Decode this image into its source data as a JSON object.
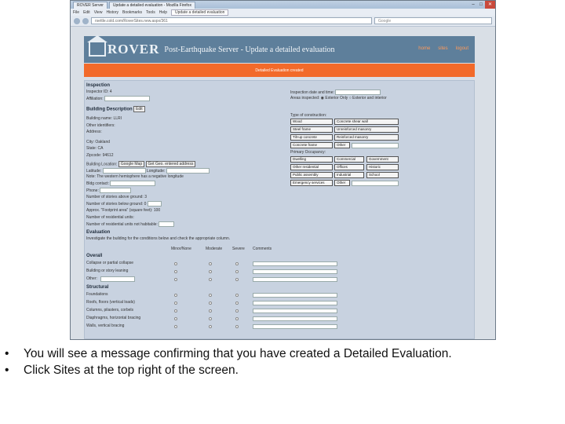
{
  "browser": {
    "tabs": [
      "ROVER Server",
      "Update a detailed evaluation - Mozilla Firefox"
    ],
    "menu": [
      "File",
      "Edit",
      "View",
      "History",
      "Bookmarks",
      "Tools",
      "Help"
    ],
    "active_tab": "Update a detailed evaluation",
    "url": "rsettle.cold.com/RoverSites.new.aspx/361",
    "search_placeholder": "Google"
  },
  "header": {
    "logo_text": "ROVER",
    "title": "Post-Earthquake Server - Update a detailed evaluation",
    "nav": [
      "home",
      "sites",
      "logout"
    ]
  },
  "flash_message": "Detailed Evaluation created",
  "inspection": {
    "heading": "Inspection",
    "inspector_id": "Inspector ID: 4",
    "affiliation_label": "Affiliation:",
    "date_label": "Inspection date and time:",
    "areas_label": "Areas inspected:",
    "areas_options": [
      "Exterior Only",
      "Exterior and interior"
    ]
  },
  "building": {
    "heading": "Building Description",
    "edit_label": "Edit",
    "lines": [
      "Building name: LLRI",
      "Other identifiers:",
      "Address:",
      "",
      "City: Oakland",
      "State: CA",
      "Zipcode: 94612"
    ],
    "latlong_label": "Building Location:",
    "google_map_btn": "Google Map",
    "geocode_btn": "Get Geo. entered address",
    "latitude_label": "Latitude:",
    "longitude_label": "Longitude:",
    "note": "Note: The western hemisphere has a negative longitude",
    "more_lines": [
      "Bldg contact:",
      "Phone:",
      "Number of stories above ground: 3",
      "Number of stories below ground: 0",
      "Approx. \"Footprint area\" (square feet): 100",
      "Number of residential units:",
      "Number of residential units not habitable:"
    ]
  },
  "construction": {
    "type_label": "Type of construction:",
    "types": [
      "Wood",
      "Concrete shear wall",
      "Steel frame",
      "Unreinforced masonry",
      "Tilt-up concrete",
      "Reinforced masonry",
      "Concrete frame",
      "Other"
    ],
    "occupancy_label": "Primary Occupancy:",
    "occupancies": [
      "Dwelling",
      "Commercial",
      "Government",
      "Other residential",
      "Offices",
      "Historic",
      "Public assembly",
      "Industrial",
      "School",
      "Emergency services",
      "Other"
    ]
  },
  "evaluation": {
    "heading": "Evaluation",
    "intro": "Investigate the building for the conditions below and check the appropriate column.",
    "columns": [
      "Minor/None",
      "Moderate",
      "Severe",
      "Comments"
    ],
    "groups": [
      {
        "name": "Overall",
        "items": [
          "Collapse or partial collapse",
          "Building or story leaning",
          "Other:"
        ]
      },
      {
        "name": "Structural",
        "items": [
          "Foundations",
          "Roofs, floors (vertical loads)",
          "Columns, pilasters, corbels",
          "Diaphragms, horizontal bracing",
          "Walls, vertical bracing"
        ]
      }
    ]
  },
  "instructions": [
    "You will see a message confirming that you have created a Detailed Evaluation.",
    "Click Sites at the top right of the screen."
  ]
}
